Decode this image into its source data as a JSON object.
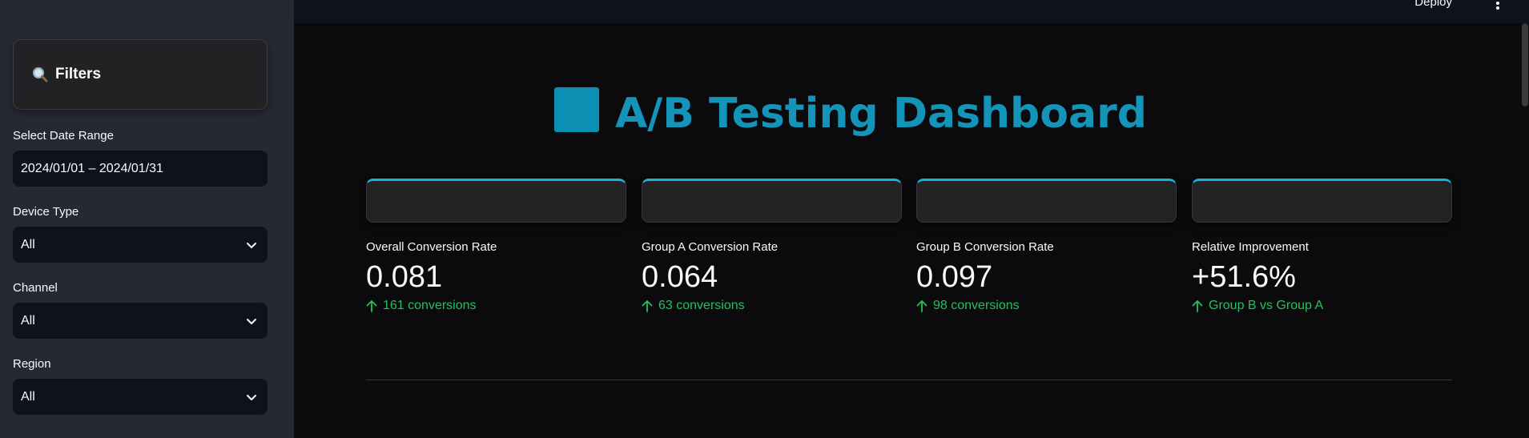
{
  "header": {
    "deploy_label": "Deploy",
    "menu_icon": "kebab-menu-icon"
  },
  "sidebar": {
    "card_title": "Filters",
    "card_icon": "magnifier-icon",
    "fields": [
      {
        "label": "Select Date Range",
        "value": "2024/01/01 – 2024/01/31"
      },
      {
        "label": "Device Type",
        "value": "All"
      },
      {
        "label": "Channel",
        "value": "All"
      },
      {
        "label": "Region",
        "value": "All"
      }
    ]
  },
  "main": {
    "title": "A/B Testing Dashboard",
    "accent_color": "#1494b8",
    "delta_color": "#21c35a",
    "metrics": [
      {
        "label": "Overall Conversion Rate",
        "value": "0.081",
        "delta": "161 conversions"
      },
      {
        "label": "Group A Conversion Rate",
        "value": "0.064",
        "delta": "63 conversions"
      },
      {
        "label": "Group B Conversion Rate",
        "value": "0.097",
        "delta": "98 conversions"
      },
      {
        "label": "Relative Improvement",
        "value": "+51.6%",
        "delta": "Group B vs Group A"
      }
    ]
  }
}
